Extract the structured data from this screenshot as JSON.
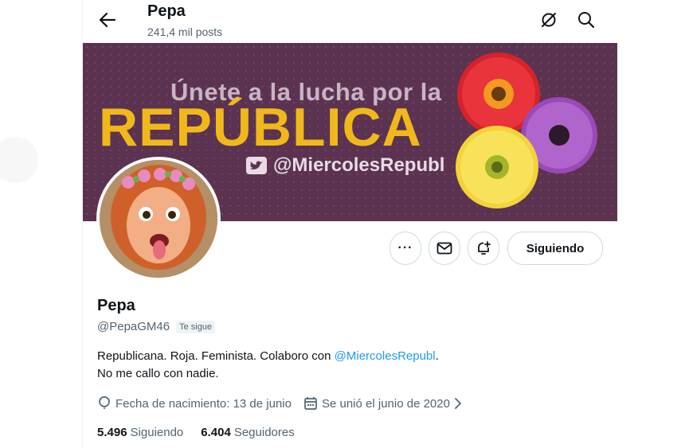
{
  "header": {
    "title": "Pepa",
    "posts": "241,4 mil posts"
  },
  "banner": {
    "line1": "Únete a la lucha por la",
    "line2": "REPÚBLICA",
    "line3": "@MiercolesRepubl"
  },
  "actions": {
    "more": "···",
    "follow_label": "Siguiendo"
  },
  "profile": {
    "name": "Pepa",
    "handle": "@PepaGM46",
    "follows_you": "Te sigue",
    "bio_line1_prefix": "Republicana. Roja. Feminista. Colaboro con ",
    "bio_mention": "@MiercolesRepubl",
    "bio_line1_suffix": ".",
    "bio_line2": "No me callo con nadie.",
    "birthday": "Fecha de nacimiento: 13 de junio",
    "joined": "Se unió el junio de 2020"
  },
  "stats": {
    "following_count": "5.496",
    "following_label": "Siguiendo",
    "followers_count": "6.404",
    "followers_label": "Seguidores"
  },
  "colors": {
    "accent": "#1d9bf0",
    "banner_bg": "#5b3350",
    "banner_yellow": "#f1b81c"
  }
}
